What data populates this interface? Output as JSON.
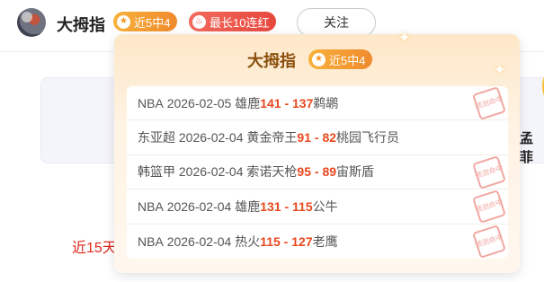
{
  "header": {
    "username": "大拇指",
    "streak_badge": "近5中4",
    "red_badge": "最长10连红",
    "follow_label": "关注"
  },
  "background": {
    "right_text": "孟菲",
    "left_text": "近15天"
  },
  "popup": {
    "title": "大拇指",
    "badge": "近5中4",
    "stamp_label": "预测命中",
    "rows": [
      {
        "league": "NBA",
        "date": "2026-02-05",
        "home": "雄鹿",
        "home_score": "141",
        "sep": " - ",
        "away_score": "137",
        "away": "鹈鹕"
      },
      {
        "league": "东亚超",
        "date": "2026-02-04",
        "home": "黄金帝王",
        "home_score": "91",
        "sep": " - ",
        "away_score": "82",
        "away": "桃园飞行员"
      },
      {
        "league": "韩篮甲",
        "date": "2026-02-04",
        "home": "索诺天枪",
        "home_score": "95",
        "sep": " - ",
        "away_score": "89",
        "away": "宙斯盾"
      },
      {
        "league": "NBA",
        "date": "2026-02-04",
        "home": "雄鹿",
        "home_score": "131",
        "sep": " - ",
        "away_score": "115",
        "away": "公牛"
      },
      {
        "league": "NBA",
        "date": "2026-02-04",
        "home": "热火",
        "home_score": "115",
        "sep": " - ",
        "away_score": "127",
        "away": "老鹰"
      }
    ]
  },
  "icons": {
    "streak_badge_icon": "star-icon",
    "red_badge_icon": "flame-icon",
    "medal_icon": "star-medal-icon"
  },
  "colors": {
    "score": "#e8481f",
    "title": "#8a4f0d",
    "stamp": "#f0a8a2",
    "streak_badge": "#f4a236",
    "red_badge": "#ec5a4c"
  }
}
